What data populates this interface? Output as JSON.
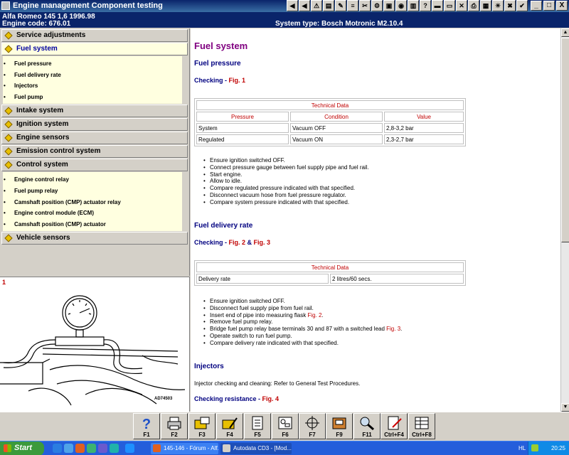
{
  "window": {
    "title": "Engine management Component testing",
    "toolbar_icons": [
      "back-icon",
      "forward-icon",
      "warning-icon",
      "document-icon",
      "edit-icon",
      "list-icon",
      "wrench-icon",
      "gear-icon",
      "disk-icon",
      "camera-icon",
      "book-icon",
      "help-icon",
      "car-icon",
      "car-alt-icon",
      "tools-icon",
      "print-icon",
      "grid-icon",
      "sun-icon",
      "close-icon",
      "doc-check-icon"
    ],
    "buttons": {
      "minimize": "_",
      "maximize": "□",
      "close": "X"
    }
  },
  "vehicle": {
    "model_line": "Alfa Romeo   145  1,6  1996.98",
    "engine_code": "Engine code: 676.01",
    "system_type": "System type: Bosch Motronic M2.10.4"
  },
  "sidebar": {
    "sections": [
      {
        "label": "Service adjustments",
        "active": false,
        "items": []
      },
      {
        "label": "Fuel system",
        "active": true,
        "items": [
          "Fuel pressure",
          "Fuel delivery rate",
          "Injectors",
          "Fuel pump"
        ]
      },
      {
        "label": "Intake system",
        "active": false,
        "items": []
      },
      {
        "label": "Ignition system",
        "active": false,
        "items": []
      },
      {
        "label": "Engine sensors",
        "active": false,
        "items": []
      },
      {
        "label": "Emission control system",
        "active": false,
        "items": []
      },
      {
        "label": "Control system",
        "active": true,
        "items": [
          "Engine control relay",
          "Fuel pump relay",
          "Camshaft position (CMP) actuator relay",
          "Engine control module (ECM)",
          "Camshaft position (CMP) actuator"
        ]
      },
      {
        "label": "Vehicle sensors",
        "active": false,
        "items": []
      }
    ]
  },
  "figure": {
    "number": "1",
    "code": "AD74503"
  },
  "content": {
    "title": "Fuel system",
    "fuel_pressure": {
      "heading": "Fuel pressure",
      "checking": "Checking - ",
      "fig": "Fig. 1",
      "table": {
        "caption": "Technical Data",
        "headers": [
          "Pressure",
          "Condition",
          "Value"
        ],
        "rows": [
          [
            "System",
            "Vacuum OFF",
            "2,8-3,2 bar"
          ],
          [
            "Regulated",
            "Vacuum ON",
            "2,3-2,7 bar"
          ]
        ]
      },
      "steps": [
        "Ensure ignition switched OFF.",
        "Connect pressure gauge between fuel supply pipe and fuel rail.",
        "Start engine.",
        "Allow to idle.",
        "Compare regulated pressure indicated with that specified.",
        "Disconnect vacuum hose from fuel pressure regulator.",
        "Compare system pressure indicated with that specified."
      ]
    },
    "fuel_delivery": {
      "heading": "Fuel delivery rate",
      "checking": "Checking - ",
      "fig_a": "Fig. 2",
      "amp": " & ",
      "fig_b": "Fig. 3",
      "table": {
        "caption": "Technical Data",
        "rows": [
          [
            "Delivery rate",
            "2 litres/60 secs."
          ]
        ]
      },
      "steps": {
        "s1": "Ensure ignition switched OFF.",
        "s2": "Disconnect fuel supply pipe from fuel rail.",
        "s3_text": "Insert end of pipe into measuring flask ",
        "s3_fig": "Fig. 2",
        "s3_end": ".",
        "s4": "Remove fuel pump relay.",
        "s5_text": "Bridge fuel pump relay base terminals 30 and 87 with a switched lead ",
        "s5_fig": "Fig. 3",
        "s5_end": ".",
        "s6": "Operate switch to run fuel pump.",
        "s7": "Compare delivery rate indicated with that specified."
      }
    },
    "injectors": {
      "heading": "Injectors",
      "text": "Injector checking and cleaning: Refer to General Test Procedures.",
      "checking": "Checking resistance - ",
      "fig": "Fig. 4"
    }
  },
  "fkeys": [
    {
      "label": "F1",
      "icon": "help-icon"
    },
    {
      "label": "F2",
      "icon": "printer-icon"
    },
    {
      "label": "F3",
      "icon": "folder-print-icon"
    },
    {
      "label": "F4",
      "icon": "folder-edit-icon"
    },
    {
      "label": "F5",
      "icon": "document-icon"
    },
    {
      "label": "F6",
      "icon": "diagram-icon"
    },
    {
      "label": "F7",
      "icon": "crosshair-icon"
    },
    {
      "label": "F9",
      "icon": "phone-icon"
    },
    {
      "label": "F11",
      "icon": "search-icon"
    },
    {
      "label": "Ctrl+F4",
      "icon": "page-pen-icon"
    },
    {
      "label": "Ctrl+F8",
      "icon": "table-icon"
    }
  ],
  "taskbar": {
    "start": "Start",
    "tasks": [
      "145-146 - Fórum - Alf...",
      "Autodata CD3 - [Mod..."
    ],
    "lang": "HL",
    "clock": "20:25"
  }
}
